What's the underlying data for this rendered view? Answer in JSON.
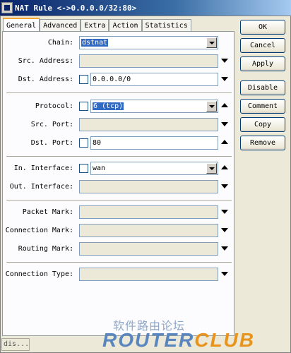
{
  "window": {
    "title": "NAT Rule <->0.0.0.0/32:80>"
  },
  "tabs": [
    {
      "label": "General",
      "active": true
    },
    {
      "label": "Advanced"
    },
    {
      "label": "Extra"
    },
    {
      "label": "Action"
    },
    {
      "label": "Statistics"
    }
  ],
  "fields": {
    "chain": {
      "label": "Chain:",
      "value": "dstnat"
    },
    "src_address": {
      "label": "Src. Address:",
      "value": ""
    },
    "dst_address": {
      "label": "Dst. Address:",
      "value": "0.0.0.0/0"
    },
    "protocol": {
      "label": "Protocol:",
      "value": "6 (tcp)"
    },
    "src_port": {
      "label": "Src. Port:",
      "value": ""
    },
    "dst_port": {
      "label": "Dst. Port:",
      "value": "80"
    },
    "in_interface": {
      "label": "In. Interface:",
      "value": "wan"
    },
    "out_interface": {
      "label": "Out. Interface:",
      "value": ""
    },
    "packet_mark": {
      "label": "Packet Mark:",
      "value": ""
    },
    "connection_mark": {
      "label": "Connection Mark:",
      "value": ""
    },
    "routing_mark": {
      "label": "Routing Mark:",
      "value": ""
    },
    "connection_type": {
      "label": "Connection Type:",
      "value": ""
    }
  },
  "buttons": {
    "ok": "OK",
    "cancel": "Cancel",
    "apply": "Apply",
    "disable": "Disable",
    "comment": "Comment",
    "copy": "Copy",
    "remove": "Remove"
  },
  "status": {
    "text": "dis..."
  },
  "watermark": {
    "cn": "软件路由论坛",
    "en_a": "ROUTER",
    "en_b": "CLUB"
  },
  "colors": {
    "accent": "#316ac5",
    "tab_highlight": "#f5a52f",
    "watermark_blue": "#5a86bf",
    "watermark_orange": "#e8931c"
  }
}
